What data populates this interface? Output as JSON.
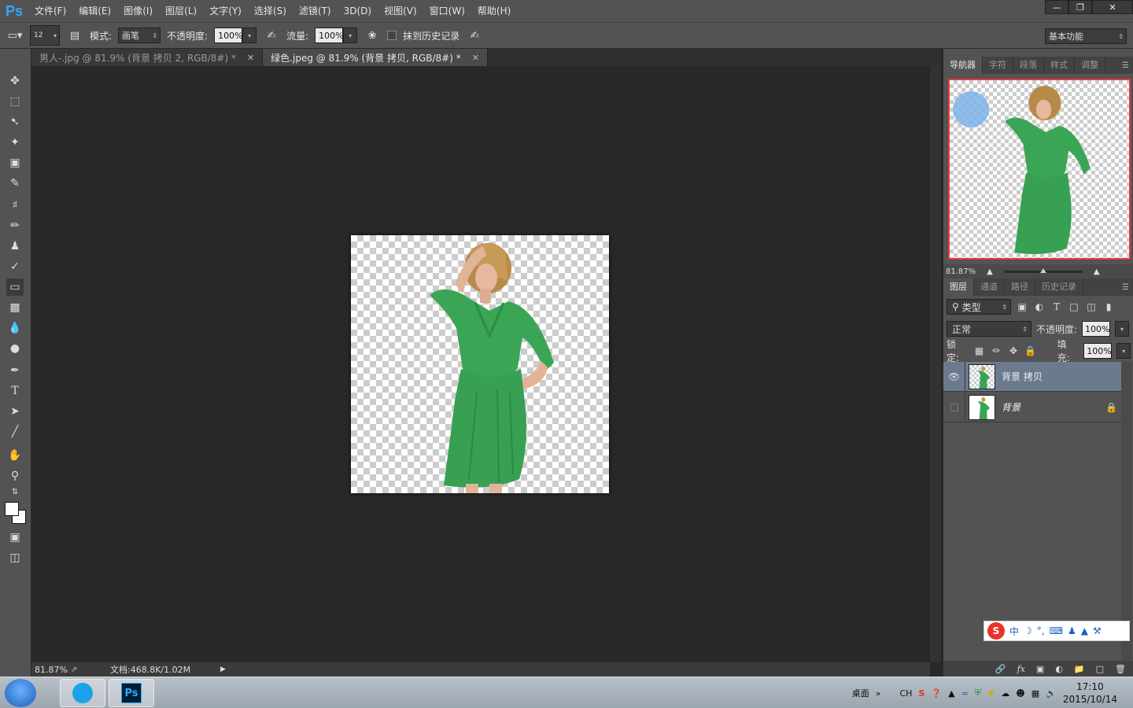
{
  "menubar": {
    "logo": "Ps",
    "items": [
      "文件(F)",
      "编辑(E)",
      "图像(I)",
      "图层(L)",
      "文字(Y)",
      "选择(S)",
      "滤镜(T)",
      "3D(D)",
      "视图(V)",
      "窗口(W)",
      "帮助(H)"
    ]
  },
  "options": {
    "brush_size": "12",
    "mode_label": "模式:",
    "mode_value": "画笔",
    "opacity_label": "不透明度:",
    "opacity_value": "100%",
    "flow_label": "流量:",
    "flow_value": "100%",
    "erase_history_label": "抹到历史记录",
    "workspace": "基本功能"
  },
  "tabs": [
    {
      "label": "男人-.jpg @ 81.9% (背景 拷贝 2, RGB/8#) *",
      "active": false
    },
    {
      "label": "绿色.jpeg @ 81.9% (背景 拷贝, RGB/8#) *",
      "active": true
    }
  ],
  "status": {
    "zoom": "81.87%",
    "doc": "文档:468.8K/1.02M"
  },
  "navigator": {
    "tabs": [
      "导航器",
      "字符",
      "段落",
      "样式",
      "调整"
    ],
    "zoom": "81.87%"
  },
  "layers_panel": {
    "tabs": [
      "图层",
      "通道",
      "路径",
      "历史记录"
    ],
    "filter_label": "类型",
    "blend_mode": "正常",
    "opacity_label": "不透明度:",
    "opacity_value": "100%",
    "lock_label": "锁定:",
    "fill_label": "填充:",
    "fill_value": "100%",
    "layers": [
      {
        "name": "背景 拷贝",
        "visible": true,
        "selected": true,
        "locked": false
      },
      {
        "name": "背景",
        "visible": false,
        "selected": false,
        "locked": true
      }
    ]
  },
  "ime": {
    "label": "中"
  },
  "taskbar": {
    "desktop_label": "桌面",
    "lang": "CH",
    "time": "17:10",
    "date": "2015/10/14"
  },
  "colors": {
    "dress": "#3aa555",
    "accent_red": "#e53a3a",
    "selected_layer": "#6c7a8e"
  }
}
